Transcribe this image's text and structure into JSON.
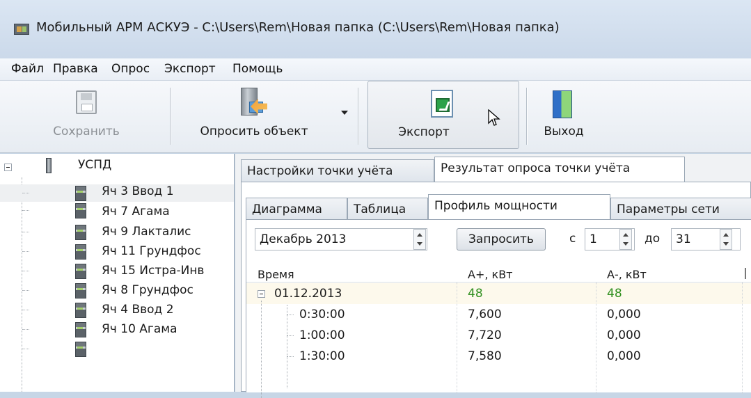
{
  "window": {
    "title": "Мобильный АРМ АСКУЭ - C:\\Users\\Rem\\Новая папка (C:\\Users\\Rem\\Новая папка)"
  },
  "menu": [
    "Файл",
    "Правка",
    "Опрос",
    "Экспорт",
    "Помощь"
  ],
  "toolbar": {
    "save": "Сохранить",
    "poll_object": "Опросить объект",
    "export": "Экспорт",
    "exit": "Выход"
  },
  "tree": {
    "root": "УСПД",
    "items": [
      "Яч 3 Ввод 1",
      "Яч 7 Агама",
      "Яч 9 Лакталис",
      "Яч 11 Грундфос",
      "Яч 15 Истра-Инв",
      "Яч 8 Грундфос",
      "Яч 4 Ввод 2",
      "Яч 10 Агама"
    ],
    "selected_index": 0
  },
  "outer_tabs": [
    "Настройки точки учёта",
    "Результат опроса точки учёта"
  ],
  "inner_tabs": [
    "Диаграмма",
    "Таблица",
    "Профиль мощности",
    "Параметры сети"
  ],
  "controls": {
    "month": "Декабрь  2013",
    "request": "Запросить",
    "from_label": "с",
    "from_value": "1",
    "to_label": "до",
    "to_value": "31"
  },
  "grid": {
    "columns": [
      "Время",
      "А+, кВт",
      "А-, кВт"
    ],
    "group": {
      "date": "01.12.2013",
      "a_plus": "48",
      "a_minus": "48"
    },
    "rows": [
      {
        "time": "0:30:00",
        "a_plus": "7,600",
        "a_minus": "0,000"
      },
      {
        "time": "1:00:00",
        "a_plus": "7,720",
        "a_minus": "0,000"
      },
      {
        "time": "1:30:00",
        "a_plus": "7,580",
        "a_minus": "0,000"
      }
    ]
  }
}
